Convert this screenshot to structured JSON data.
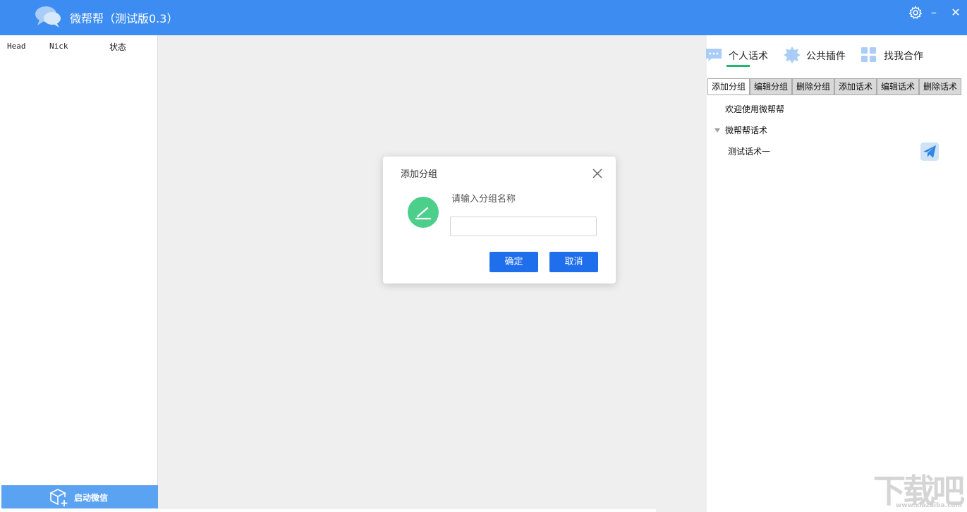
{
  "app": {
    "title": "微帮帮（测试版0.3）"
  },
  "window_controls": {
    "settings_icon": "gear-icon",
    "minimize_glyph": "–",
    "close_glyph": "✕"
  },
  "contact_list": {
    "columns": [
      "Head",
      "Nick",
      "状态"
    ],
    "start_wechat_label": "启动微信"
  },
  "right_panel": {
    "tabs": [
      {
        "label": "个人话术",
        "icon": "chat-bubble-icon",
        "active": true
      },
      {
        "label": "公共插件",
        "icon": "puzzle-icon",
        "active": false
      },
      {
        "label": "找我合作",
        "icon": "grid-icon",
        "active": false
      }
    ],
    "toolbar": [
      "添加分组",
      "编辑分组",
      "删除分组",
      "添加话术",
      "编辑话术",
      "删除话术"
    ],
    "tree": {
      "welcome": "欢迎使用微帮帮",
      "group_name": "微帮帮话术",
      "script_item": "测试话术一"
    }
  },
  "dialog": {
    "title": "添加分组",
    "prompt": "请输入分组名称",
    "input_value": "",
    "confirm_label": "确定",
    "cancel_label": "取消"
  },
  "watermark": {
    "text": "下载吧",
    "url": "www.xiazaiba.com"
  },
  "colors": {
    "titlebar": "#3d8cf2",
    "accent_green": "#1fb86e",
    "primary_button": "#1f6fed",
    "start_button": "#5aa2f2"
  }
}
